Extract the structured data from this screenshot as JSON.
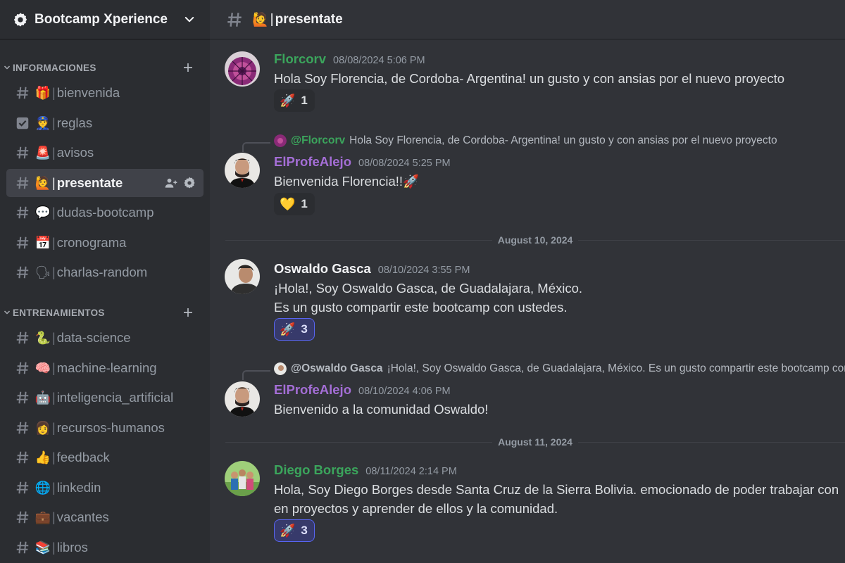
{
  "server": {
    "name": "Bootcamp Xperience"
  },
  "categories": [
    {
      "label": "INFORMACIONES"
    },
    {
      "label": "ENTRENAMIENTOS"
    }
  ],
  "channels": [
    {
      "emoji": "🎁",
      "name": "bienvenida"
    },
    {
      "emoji": "👮",
      "name": "reglas"
    },
    {
      "emoji": "🚨",
      "name": "avisos"
    },
    {
      "emoji": "🙋",
      "name": "presentate"
    },
    {
      "emoji": "💬",
      "name": "dudas-bootcamp"
    },
    {
      "emoji": "📅",
      "name": "cronograma"
    },
    {
      "emoji": "🗣",
      "name": "charlas-random"
    },
    {
      "emoji": "🐍",
      "name": "data-science"
    },
    {
      "emoji": "🧠",
      "name": "machine-learning"
    },
    {
      "emoji": "🤖",
      "name": "inteligencia_artificial"
    },
    {
      "emoji": "👩",
      "name": "recursos-humanos"
    },
    {
      "emoji": "👍",
      "name": "feedback"
    },
    {
      "emoji": "🌐",
      "name": "linkedin"
    },
    {
      "emoji": "💼",
      "name": "vacantes"
    },
    {
      "emoji": "📚",
      "name": "libros"
    }
  ],
  "separator": "|",
  "current_channel": {
    "emoji": "🙋",
    "title": "presentate"
  },
  "messages": [
    {
      "author": "Florcorv",
      "author_color": "#3ba55c",
      "timestamp": "08/08/2024 5:06 PM",
      "lines": [
        "Hola Soy Florencia, de Cordoba- Argentina!  un gusto y con ansias por el nuevo proyecto"
      ],
      "reaction": {
        "emoji": "🚀",
        "count": "1"
      }
    },
    {
      "reply_to": {
        "author": "@Florcorv",
        "text": "Hola Soy Florencia, de Cordoba- Argentina!  un gusto y con ansias por el nuevo proyecto"
      },
      "author": "ElProfeAlejo",
      "author_color": "#a46ed6",
      "timestamp": "08/08/2024 5:25 PM",
      "lines": [
        "Bienvenida Florencia!!🚀"
      ],
      "reaction": {
        "emoji": "💛",
        "count": "1"
      }
    },
    {
      "author": "Oswaldo Gasca",
      "author_color": "#f2f3f5",
      "timestamp": "08/10/2024 3:55 PM",
      "lines": [
        "¡Hola!, Soy Oswaldo Gasca, de Guadalajara, México.",
        "Es un gusto compartir este bootcamp con ustedes."
      ],
      "reaction": {
        "emoji": "🚀",
        "count": "3"
      }
    },
    {
      "reply_to": {
        "author": "@Oswaldo Gasca",
        "text": "¡Hola!, Soy Oswaldo Gasca, de Guadalajara, México. Es un gusto compartir este bootcamp con ustedes."
      },
      "author": "ElProfeAlejo",
      "author_color": "#a46ed6",
      "timestamp": "08/10/2024 4:06 PM",
      "lines": [
        "Bienvenido a la comunidad Oswaldo!"
      ]
    },
    {
      "author": "Diego Borges",
      "author_color": "#3ba55c",
      "timestamp": "08/11/2024 2:14 PM",
      "lines": [
        "Hola, Soy Diego Borges desde Santa Cruz de la Sierra Bolivia. emocionado de poder trabajar con",
        "en proyectos y aprender de ellos y la comunidad."
      ],
      "reaction": {
        "emoji": "🚀",
        "count": "3"
      }
    }
  ],
  "dividers": [
    "August 10, 2024",
    "August 11, 2024"
  ]
}
